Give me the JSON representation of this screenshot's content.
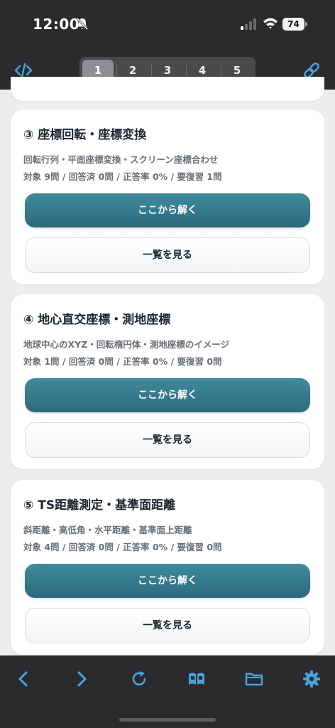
{
  "status_bar": {
    "time": "12:00",
    "battery": "74",
    "icons": [
      "bell-slash-icon",
      "signal-icon",
      "wifi-icon",
      "battery-icon"
    ]
  },
  "toolbar": {
    "left_icon": "code-icon",
    "right_icon": "link-icon",
    "segments": [
      "1",
      "2",
      "3",
      "4",
      "5"
    ],
    "active_segment": "1"
  },
  "cards": [
    {
      "title": "③ 座標回転・座標変換",
      "description": "回転行列・平面座標変換・スクリーン座標合わせ",
      "stats": "対象 9問 / 回答済 0問 / 正答率 0% / 要復習 1問",
      "primary_button": "ここから解く",
      "secondary_button": "一覧を見る"
    },
    {
      "title": "④ 地心直交座標・測地座標",
      "description": "地球中心のXYZ・回転楕円体・測地座標のイメージ",
      "stats": "対象 1問 / 回答済 0問 / 正答率 0% / 要復習 0問",
      "primary_button": "ここから解く",
      "secondary_button": "一覧を見る"
    },
    {
      "title": "⑤ TS距離測定・基準面距離",
      "description": "斜距離・高低角・水平距離・基準面上距離",
      "stats": "対象 4問 / 回答済 0問 / 正答率 0% / 要復習 0問",
      "primary_button": "ここから解く",
      "secondary_button": "一覧を見る"
    }
  ],
  "bottom_toolbar": {
    "icons": [
      "back-icon",
      "forward-icon",
      "reload-icon",
      "book-icon",
      "folder-icon",
      "gear-icon"
    ]
  },
  "colors": {
    "accent": "#4aa3e0",
    "primary_button": "#347a8c",
    "toolbar_bg": "#2b2b2d",
    "page_bg": "#efedeb"
  }
}
